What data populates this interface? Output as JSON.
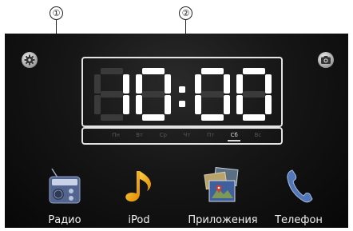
{
  "callouts": [
    "①",
    "②"
  ],
  "clock": {
    "time": "10:00"
  },
  "days": [
    "Пн",
    "Вт",
    "Ср",
    "Чт",
    "Пт",
    "Сб",
    "Вс"
  ],
  "active_day": "Сб",
  "apps": [
    {
      "label": "Радио",
      "icon": "radio-icon"
    },
    {
      "label": "iPod",
      "icon": "music-note-icon"
    },
    {
      "label": "Приложения",
      "icon": "applications-icon"
    },
    {
      "label": "Телефон",
      "icon": "phone-icon"
    }
  ],
  "corner_buttons": {
    "left": "gear-icon",
    "right": "camera-icon"
  },
  "colors": {
    "background": "#0c0c0c",
    "frame": "#e3e3e3",
    "digits": "#ffffff",
    "ghost_segments": "#3a3a3a"
  }
}
